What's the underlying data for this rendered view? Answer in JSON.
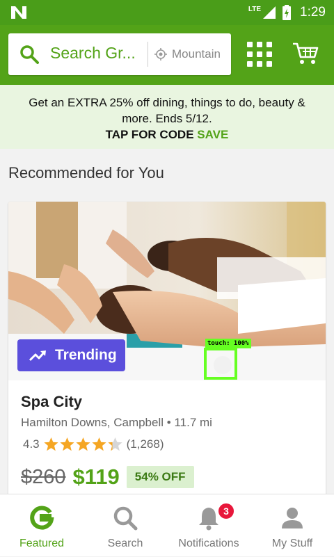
{
  "status_bar": {
    "network": "LTE",
    "time": "1:29"
  },
  "search": {
    "placeholder": "Search Gr...",
    "location": "Mountain"
  },
  "promo": {
    "text": "Get an EXTRA 25% off dining, things to do, beauty & more. Ends 5/12.",
    "cta": "TAP FOR CODE",
    "code": "SAVE"
  },
  "section_title": "Recommended for You",
  "deal": {
    "badge": "Trending",
    "title": "Spa City",
    "location": "Hamilton Downs, Campbell",
    "distance": "11.7 mi",
    "rating": "4.3",
    "rating_value": 4.3,
    "reviews": "(1,268)",
    "original_price": "$260",
    "price": "$119",
    "discount": "54% OFF"
  },
  "touch_indicator": "touch: 100%",
  "nav": {
    "items": [
      {
        "label": "Featured",
        "icon": "groupon-g-icon",
        "active": true
      },
      {
        "label": "Search",
        "icon": "search-icon"
      },
      {
        "label": "Notifications",
        "icon": "bell-icon",
        "badge": "3"
      },
      {
        "label": "My Stuff",
        "icon": "person-icon"
      }
    ]
  },
  "colors": {
    "brand_green": "#53a318",
    "status_green": "#4a9d19",
    "trending_purple": "#5b4fdc",
    "star_gold": "#f5a623",
    "badge_red": "#e8173b"
  }
}
